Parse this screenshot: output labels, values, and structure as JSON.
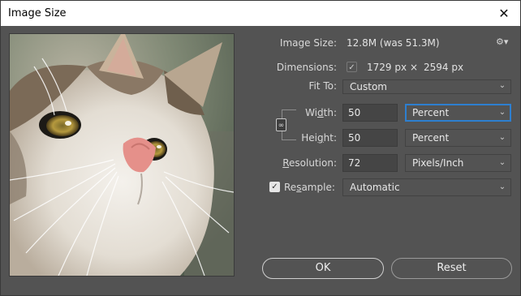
{
  "window": {
    "title": "Image Size",
    "close_glyph": "✕"
  },
  "image_size": {
    "label": "Image Size:",
    "value": "12.8M (was 51.3M)"
  },
  "settings_icon_glyph": "⚙▾",
  "dimensions": {
    "label": "Dimensions:",
    "check_glyph": "✓",
    "width_value": "1729 px",
    "times": "×",
    "height_value": "2594 px"
  },
  "fit_to": {
    "label": "Fit To:",
    "value": "Custom"
  },
  "width": {
    "label_prefix": "Wi",
    "label_underlined": "d",
    "label_suffix": "th:",
    "value": "50",
    "unit": "Percent"
  },
  "height": {
    "label_prefix": "Hei",
    "label_underlined": "g",
    "label_suffix": "ht:",
    "value": "50",
    "unit": "Percent"
  },
  "resolution": {
    "label_underlined": "R",
    "label_suffix": "esolution:",
    "value": "72",
    "unit": "Pixels/Inch"
  },
  "resample": {
    "label_prefix": "Re",
    "label_underlined": "s",
    "label_suffix": "ample:",
    "checked": true,
    "value": "Automatic"
  },
  "link_icon_glyph": "🔗",
  "chevron_glyph": "⌄",
  "buttons": {
    "ok": "OK",
    "reset": "Reset"
  },
  "colors": {
    "dialog_bg": "#535353",
    "focus_blue": "#2d7fd0",
    "field_bg": "#454545",
    "checkbox_bg": "#e6e6e6"
  }
}
